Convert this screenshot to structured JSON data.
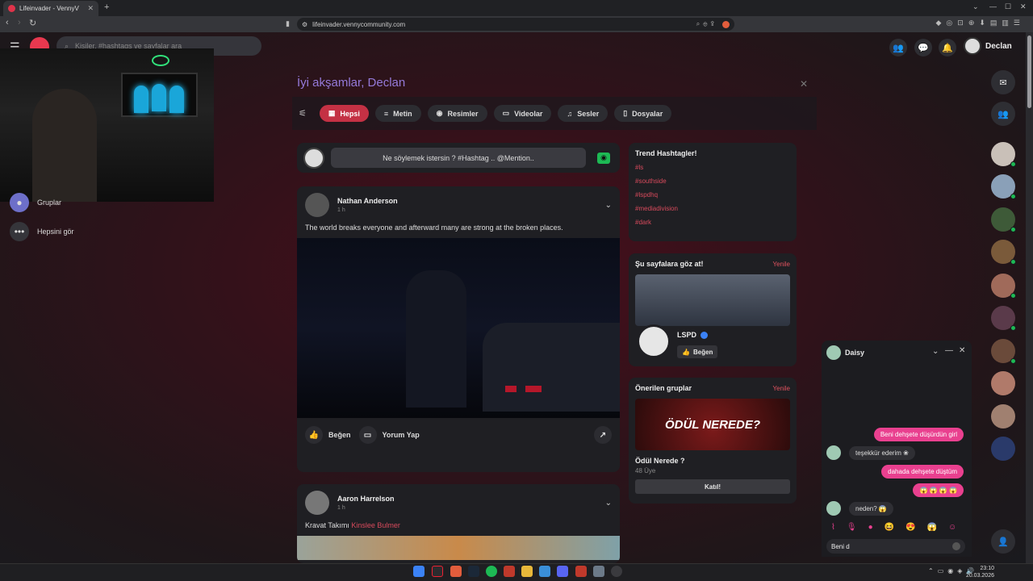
{
  "browser": {
    "tab_title": "Lifeinvader - VennyV",
    "url": "lifeinvader.vennycommunity.com"
  },
  "topnav": {
    "search_placeholder": "Kişiler, #hashtags ve sayfalar ara",
    "user_name": "Declan"
  },
  "sidebar": {
    "items": [
      {
        "label": "Gruplar",
        "icon": "groups-icon"
      },
      {
        "label": "Hepsini gör",
        "icon": "more-dots-icon"
      }
    ]
  },
  "main": {
    "greeting": "İyi akşamlar, Declan",
    "filters": [
      {
        "label": "Hepsi",
        "icon": "grid-icon",
        "active": true
      },
      {
        "label": "Metin",
        "icon": "lines-icon",
        "active": false
      },
      {
        "label": "Resimler",
        "icon": "camera-icon",
        "active": false
      },
      {
        "label": "Videolar",
        "icon": "video-icon",
        "active": false
      },
      {
        "label": "Sesler",
        "icon": "music-icon",
        "active": false
      },
      {
        "label": "Dosyalar",
        "icon": "file-icon",
        "active": false
      }
    ],
    "composer_placeholder": "Ne söylemek istersin ? #Hashtag .. @Mention..",
    "posts": [
      {
        "author": "Nathan Anderson",
        "time": "1 h",
        "text": "The world breaks everyone and afterward many are strong at the broken places.",
        "like": "Beğen",
        "comment": "Yorum Yap"
      },
      {
        "author": "Aaron Harrelson",
        "time": "1 h",
        "text": "Kravat Takımı",
        "mention": "Kinslee Bulmer"
      }
    ]
  },
  "right": {
    "trending": {
      "title": "Trend Hashtagler!",
      "tags": [
        "#ls",
        "#southside",
        "#lspdhq",
        "#mediadivision",
        "#dark"
      ]
    },
    "pages": {
      "title": "Şu sayfalara göz at!",
      "refresh": "Yenile",
      "page_name": "LSPD",
      "like": "Beğen"
    },
    "groups": {
      "title": "Önerilen gruplar",
      "refresh": "Yenile",
      "banner_text": "ÖDÜL NEREDE?",
      "group_name": "Ödül Nerede ?",
      "members": "48 Üye",
      "join": "Katıl!"
    }
  },
  "chat": {
    "contact": "Daisy",
    "messages": [
      {
        "from": "me",
        "text": "Beni dehşete düşürdün girl"
      },
      {
        "from": "them",
        "text": "teşekkür ederim ❀"
      },
      {
        "from": "me",
        "text": "dahada dehşete düştüm"
      },
      {
        "from": "me",
        "text": "😱 😱 😱 😱"
      },
      {
        "from": "them",
        "text": "neden? 😱"
      }
    ],
    "input_value": "Beni d"
  },
  "taskbar": {
    "time": "23:10",
    "date": "20.03.2026"
  },
  "colors": {
    "accent": "#c43144",
    "link": "#d84a5c",
    "chat_bubble": "#e9408f",
    "greeting": "#a78bfa"
  }
}
